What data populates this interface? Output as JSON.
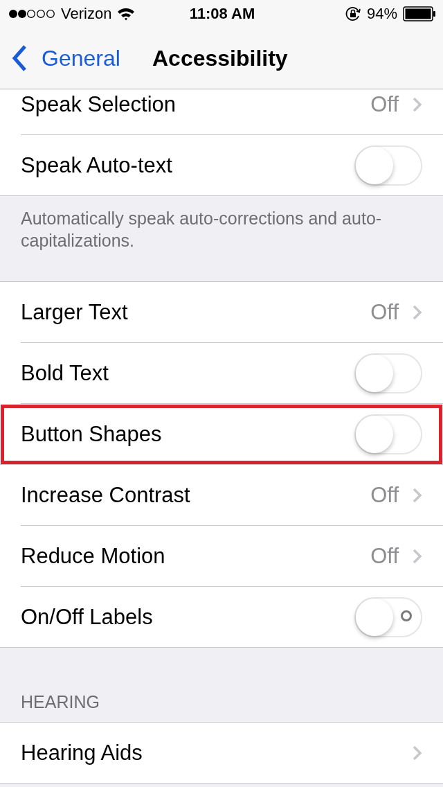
{
  "status_bar": {
    "carrier": "Verizon",
    "time": "11:08 AM",
    "battery": "94%"
  },
  "nav": {
    "back": "General",
    "title": "Accessibility"
  },
  "groups": [
    {
      "rows": [
        {
          "kind": "disclosure",
          "label": "Speak Selection",
          "value": "Off",
          "highlighted": false
        },
        {
          "kind": "toggle",
          "label": "Speak Auto-text",
          "on": false,
          "labels": false,
          "highlighted": false
        }
      ],
      "footer": "Automatically speak auto-corrections and auto-capitalizations."
    },
    {
      "rows": [
        {
          "kind": "disclosure",
          "label": "Larger Text",
          "value": "Off",
          "highlighted": false
        },
        {
          "kind": "toggle",
          "label": "Bold Text",
          "on": false,
          "labels": false,
          "highlighted": false
        },
        {
          "kind": "toggle",
          "label": "Button Shapes",
          "on": false,
          "labels": false,
          "highlighted": true
        },
        {
          "kind": "disclosure",
          "label": "Increase Contrast",
          "value": "Off",
          "highlighted": false
        },
        {
          "kind": "disclosure",
          "label": "Reduce Motion",
          "value": "Off",
          "highlighted": false
        },
        {
          "kind": "toggle",
          "label": "On/Off Labels",
          "on": false,
          "labels": true,
          "highlighted": false
        }
      ]
    },
    {
      "header": "HEARING",
      "rows": [
        {
          "kind": "disclosure",
          "label": "Hearing Aids",
          "highlighted": false
        }
      ]
    }
  ]
}
